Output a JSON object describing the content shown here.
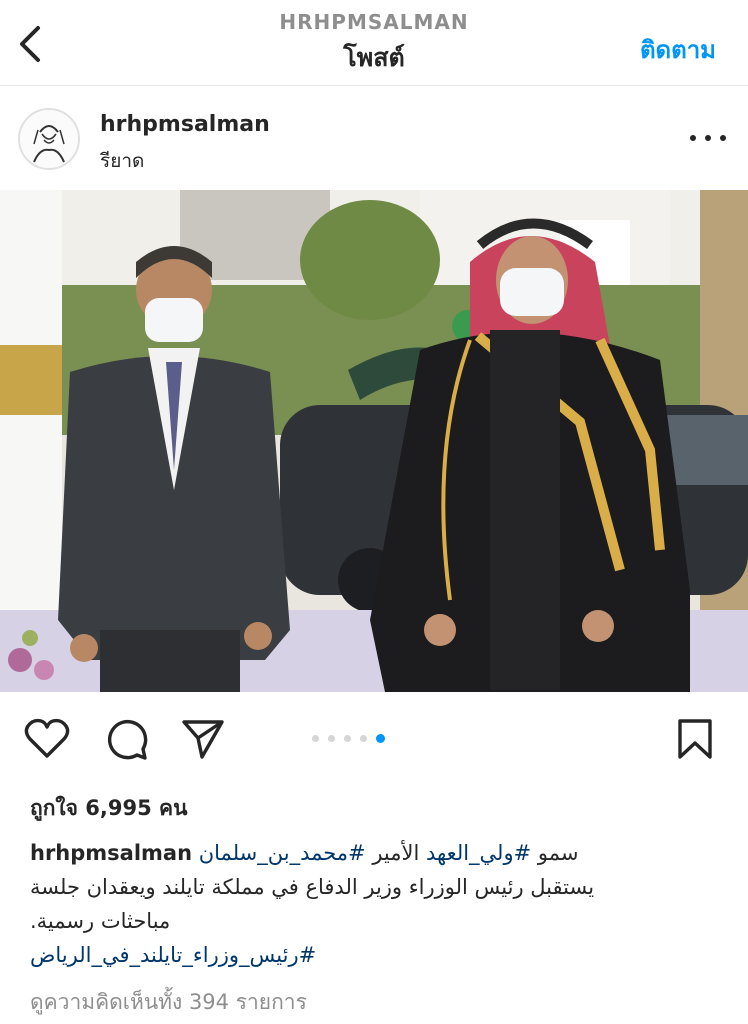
{
  "topbar": {
    "username_caps": "HRHPMSALMAN",
    "title": "โพสต์",
    "follow_label": "ติดตาม",
    "back_icon": "chevron-left-icon"
  },
  "post": {
    "username": "hrhpmsalman",
    "location": "รียาด",
    "more_icon": "more-horizontal-icon"
  },
  "photo": {
    "description_icon": "photo"
  },
  "actions": {
    "like_icon": "heart-icon",
    "comment_icon": "comment-icon",
    "share_icon": "send-icon",
    "save_icon": "bookmark-icon",
    "carousel_total": 5,
    "carousel_active": 5
  },
  "likes": {
    "text": "ถูกใจ 6,995 คน"
  },
  "caption": {
    "user": "hrhpmsalman",
    "line1_prefix": "سمو ",
    "tag_crown_prince": "#ولي_العهد",
    "line1_mid": " الأمير ",
    "tag_name": "#محمد_بن_سلمان",
    "line2": "يستقبل رئيس الوزراء وزير الدفاع في مملكة تايلند ويعقدان جلسة",
    "line3": "مباحثات رسمية.",
    "tag_line4": "#رئيس_وزراء_تايلند_في_الرياض"
  },
  "comments": {
    "text": "ดูความคิดเห็นทั้ง 394 รายการ"
  },
  "colors": {
    "accent": "#0095f6",
    "hashtag": "#00376b",
    "muted": "#8e8e8e"
  }
}
